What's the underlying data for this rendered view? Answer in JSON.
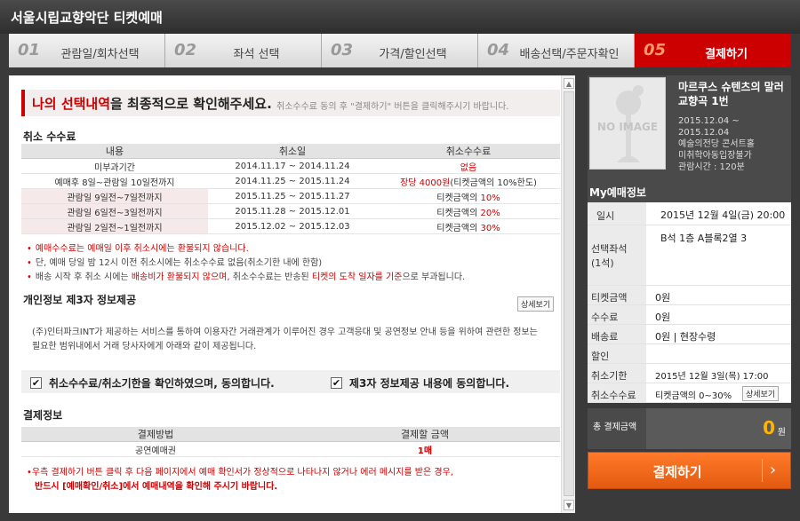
{
  "header": {
    "title": "서울시립교향악단 티켓예매"
  },
  "steps": [
    {
      "num": "01",
      "label": "관람일/회차선택"
    },
    {
      "num": "02",
      "label": "좌석 선택"
    },
    {
      "num": "03",
      "label": "가격/할인선택"
    },
    {
      "num": "04",
      "label": "배송선택/주문자확인"
    },
    {
      "num": "05",
      "label": "결제하기"
    }
  ],
  "banner": {
    "highlight": "나의 선택내역",
    "rest": "을 최종적으로 확인해주세요.",
    "hint": "취소수수료 동의 후 \"결제하기\" 버튼을 클릭해주시기 바랍니다."
  },
  "cancel": {
    "title": "취소 수수료",
    "headers": [
      "내용",
      "취소일",
      "취소수수료"
    ],
    "rows": [
      {
        "content": "미부과기간",
        "date": "2014.11.17 ~ 2014.11.24",
        "fee": "없음"
      },
      {
        "content": "예매후 8일~관람일 10일전까지",
        "date": "2014.11.25 ~ 2015.11.24",
        "fee_red": "장당 4000원",
        "fee_rest": "(티켓금액의 10%한도)"
      },
      {
        "content": "관람일 9일전~7일전까지",
        "date": "2015.11.25 ~ 2015.11.27",
        "fee_pre": "티켓금액의 ",
        "fee_red": "10%"
      },
      {
        "content": "관람일 6일전~3일전까지",
        "date": "2015.11.28 ~ 2015.12.01",
        "fee_pre": "티켓금액의 ",
        "fee_red": "20%"
      },
      {
        "content": "관람일 2일전~1일전까지",
        "date": "2015.12.02 ~ 2015.12.03",
        "fee_pre": "티켓금액의 ",
        "fee_red": "30%"
      }
    ],
    "notes": {
      "n1": "예매수수료는 예매일 이후 취소시에는 환불되지 않습니다.",
      "n2": "단, 예매 당일 밤 12시 이전 취소시에는 취소수수료 없음(취소기한 내에 한함)",
      "n3_a": "배송 시작 후 취소 시에는 ",
      "n3_b": "배송비가 환불되지 않으며,",
      "n3_c": " 취소수수료는 반송된 ",
      "n3_d": "티켓의 도착 일자를 기준",
      "n3_e": "으로 부과됩니다."
    }
  },
  "privacy": {
    "title": "개인정보 제3자 정보제공",
    "detail": "상세보기",
    "text": "(주)인터파크INT가 제공하는 서비스를 통하여 이용자간 거래관계가 이루어진 경우 고객응대 및 공연정보 안내 등을 위하여 관련한 정보는 필요한 범위내에서 거래 당사자에게 아래와 같이 제공됩니다."
  },
  "agree": {
    "a1": "취소수수료/취소기한을 확인하였으며, 동의합니다.",
    "a2": "제3자 정보제공 내용에 동의합니다.",
    "check": "✔"
  },
  "payment": {
    "title": "결제정보",
    "headers": [
      "결제방법",
      "결제할 금액"
    ],
    "method": "공연예매권",
    "amount": "1매"
  },
  "warning": {
    "w1": "우측 결제하기 버튼 클릭 후 다음 페이지에서 예매 확인서가 정상적으로 나타나지 않거나 에러 메시지를 받은 경우,",
    "w2": "반드시 [예매확인/취소]에서 예매내역을 확인해 주시기 바랍니다."
  },
  "show": {
    "noimage": "NO IMAGE",
    "title": "마르쿠스 슈텐츠의 말러 교향곡 1번",
    "period": "2015.12.04 ~ 2015.12.04",
    "venue": "예술의전당 콘서트홀",
    "age": "미취학아동입장불가",
    "runtime": "관람시간 : 120분"
  },
  "my": {
    "title": "My예매정보",
    "date_k": "일시",
    "date_v": "2015년 12월 4일(금) 20:00",
    "seat_k": "선택좌석",
    "seat_k2": "(1석)",
    "seat_v": "B석 1층 A블록2열 3",
    "ticket_k": "티켓금액",
    "ticket_v": "0원",
    "fee_k": "수수료",
    "fee_v": "0원",
    "ship_k": "배송료",
    "ship_v": "0원 | 현장수령",
    "disc_k": "할인",
    "deadline_k": "취소기한",
    "deadline_v": "2015년 12월 3일(목) 17:00",
    "cfee_k": "취소수수료",
    "cfee_v": "티켓금액의 0~30%",
    "cfee_btn": "상세보기",
    "total_k": "총 결제금액",
    "total_v": "0",
    "total_u": "원",
    "pay": "결제하기",
    "arrow": "›"
  },
  "scroll": {
    "up": "▲",
    "down": "▼"
  }
}
